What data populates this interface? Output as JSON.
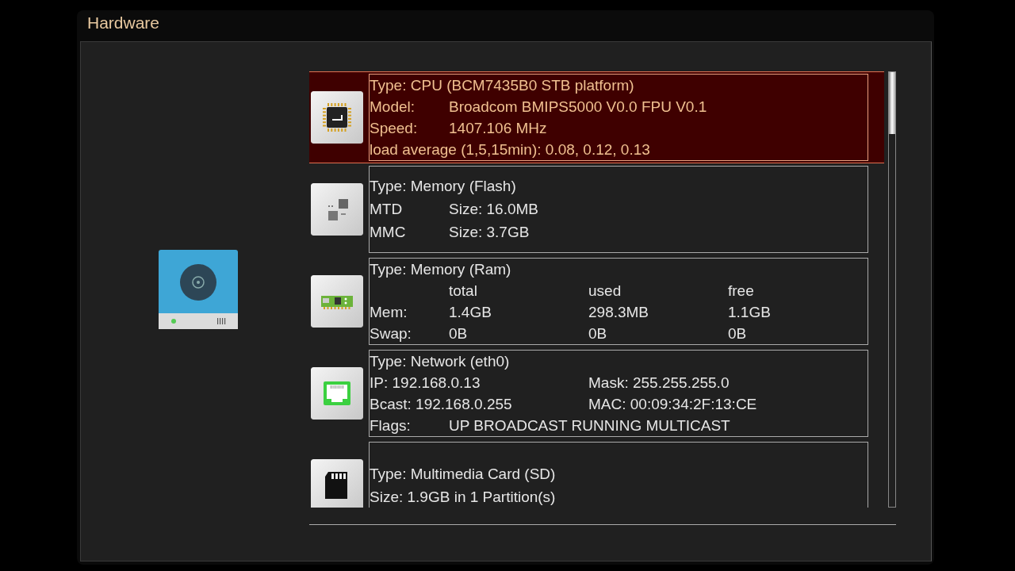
{
  "window": {
    "title": "Hardware"
  },
  "devices": [
    {
      "kind": "cpu",
      "selected": true,
      "rows": [
        {
          "kind": "line",
          "cells": [
            "Type: CPU (BCM7435B0 STB platform)"
          ]
        },
        {
          "kind": "pair",
          "cells": [
            "Model:",
            "Broadcom BMIPS5000 V0.0  FPU V0.1"
          ]
        },
        {
          "kind": "pair",
          "cells": [
            "Speed:",
            " 1407.106 MHz"
          ]
        },
        {
          "kind": "line",
          "cells": [
            "load average (1,5,15min):  0.08, 0.12, 0.13"
          ]
        }
      ]
    },
    {
      "kind": "flash",
      "selected": false,
      "rows": [
        {
          "kind": "line",
          "cells": [
            "Type: Memory (Flash)"
          ]
        },
        {
          "kind": "pair",
          "cells": [
            "MTD",
            "Size: 16.0MB"
          ]
        },
        {
          "kind": "pair",
          "cells": [
            "MMC",
            "Size: 3.7GB"
          ]
        }
      ]
    },
    {
      "kind": "ram",
      "selected": false,
      "rows": [
        {
          "kind": "line",
          "cells": [
            "Type: Memory (Ram)"
          ]
        },
        {
          "kind": "table",
          "cells": [
            "",
            "total",
            "used",
            "free"
          ]
        },
        {
          "kind": "table",
          "cells": [
            "Mem:",
            "1.4GB",
            "298.3MB",
            "1.1GB"
          ]
        },
        {
          "kind": "table",
          "cells": [
            "Swap:",
            "0B",
            "0B",
            "0B"
          ]
        }
      ]
    },
    {
      "kind": "network",
      "selected": false,
      "rows": [
        {
          "kind": "line",
          "cells": [
            "Type: Network (eth0)"
          ]
        },
        {
          "kind": "split",
          "cells": [
            "IP:  192.168.0.13",
            "Mask:  255.255.255.0"
          ]
        },
        {
          "kind": "split",
          "cells": [
            "Bcast:  192.168.0.255",
            "MAC:  00:09:34:2F:13:CE"
          ]
        },
        {
          "kind": "pair",
          "cells": [
            "Flags:",
            "UP BROADCAST RUNNING MULTICAST"
          ]
        }
      ]
    },
    {
      "kind": "sd",
      "selected": false,
      "rows": [
        {
          "kind": "line",
          "cells": [
            "Type: Multimedia Card (SD)"
          ]
        },
        {
          "kind": "line",
          "cells": [
            "Size: 1.9GB in 1 Partition(s)"
          ]
        }
      ]
    }
  ]
}
